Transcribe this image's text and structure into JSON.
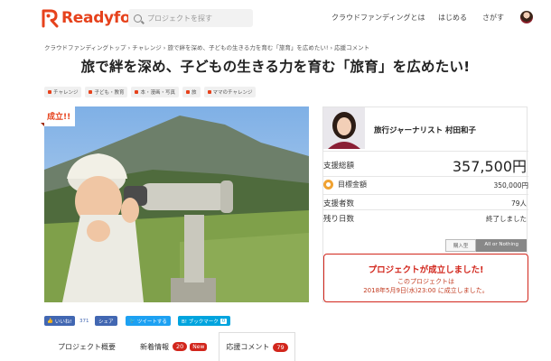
{
  "header": {
    "brand": "Readyfor",
    "search_placeholder": "プロジェクトを探す",
    "nav": [
      "クラウドファンディングとは",
      "はじめる",
      "さがす"
    ]
  },
  "breadcrumb": "クラウドファンディングトップ › チャレンジ › 旅で絆を深め、子どもの生きる力を育む「旅育」を広めたい! › 応援コメント",
  "title": "旅で絆を深め、子どもの生きる力を育む「旅育」を広めたい!",
  "tags": [
    "チャレンジ",
    "子ども・教育",
    "本・漫画・写真",
    "旅",
    "ママのチャレンジ"
  ],
  "ribbon": "成立!!",
  "owner": {
    "name": "旅行ジャーナリスト 村田和子"
  },
  "stats": {
    "total_label": "支援総額",
    "total_amount": "357,500円",
    "goal_label": "目標金額",
    "goal_amount": "350,000円",
    "supporters_label": "支援者数",
    "supporters_value": "79人",
    "remaining_label": "残り日数",
    "remaining_value": "終了しました"
  },
  "type_switch": {
    "option_1": "購入型",
    "option_2": "All or Nothing",
    "active": "All or Nothing"
  },
  "success": {
    "title": "プロジェクトが成立しました!",
    "line_1": "このプロジェクトは",
    "line_2": "2018年5月9日(水)23:00 に成立しました。"
  },
  "social": {
    "like_label": "いいね!",
    "like_count": "371",
    "share_label": "シェア",
    "tweet_label": "ツイートする",
    "hatena_label": "B! ブックマーク",
    "hatena_count": "0"
  },
  "tabs": {
    "overview": "プロジェクト概要",
    "news": "新着情報",
    "news_count": "20",
    "news_badge": "New",
    "comments": "応援コメント",
    "comments_count": "79"
  },
  "colors": {
    "brand": "#e6421c",
    "success": "#d2261c",
    "facebook": "#4267b2",
    "twitter": "#1da1f2",
    "hatena": "#00a4de"
  }
}
